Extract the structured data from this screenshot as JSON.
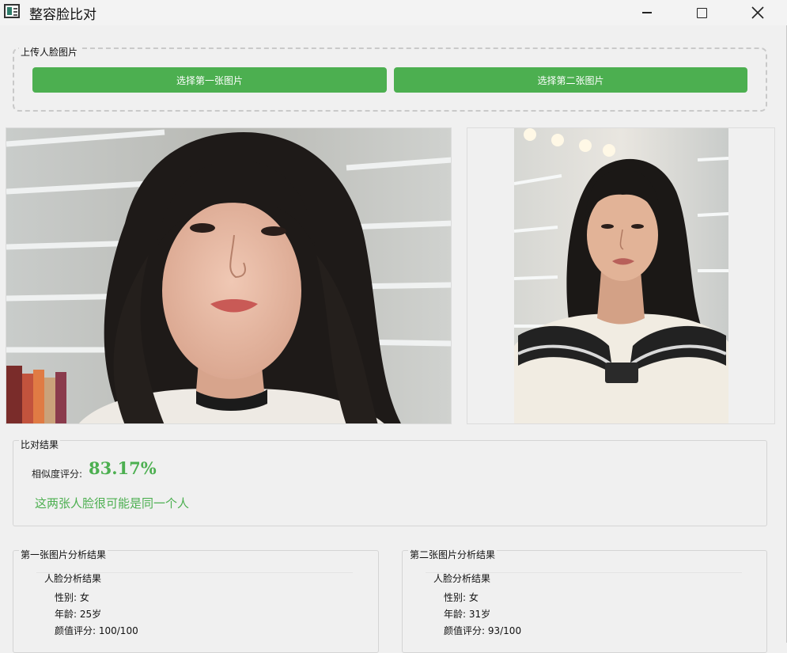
{
  "window": {
    "title": "整容脸比对"
  },
  "upload": {
    "group_title": "上传人脸图片",
    "button1_label": "选择第一张图片",
    "button2_label": "选择第二张图片"
  },
  "result": {
    "group_title": "比对结果",
    "score_label": "相似度评分:",
    "score_value": "83.17%",
    "verdict": "这两张人脸很可能是同一个人"
  },
  "analysis": [
    {
      "group_title": "第一张图片分析结果",
      "inner_title": "人脸分析结果",
      "gender": "性别: 女",
      "age": "年龄: 25岁",
      "beauty": "颜值评分: 100/100"
    },
    {
      "group_title": "第二张图片分析结果",
      "inner_title": "人脸分析结果",
      "gender": "性别: 女",
      "age": "年龄: 31岁",
      "beauty": "颜值评分: 93/100"
    }
  ],
  "colors": {
    "accent": "#4caf50",
    "window_bg": "#f0f0f0"
  }
}
